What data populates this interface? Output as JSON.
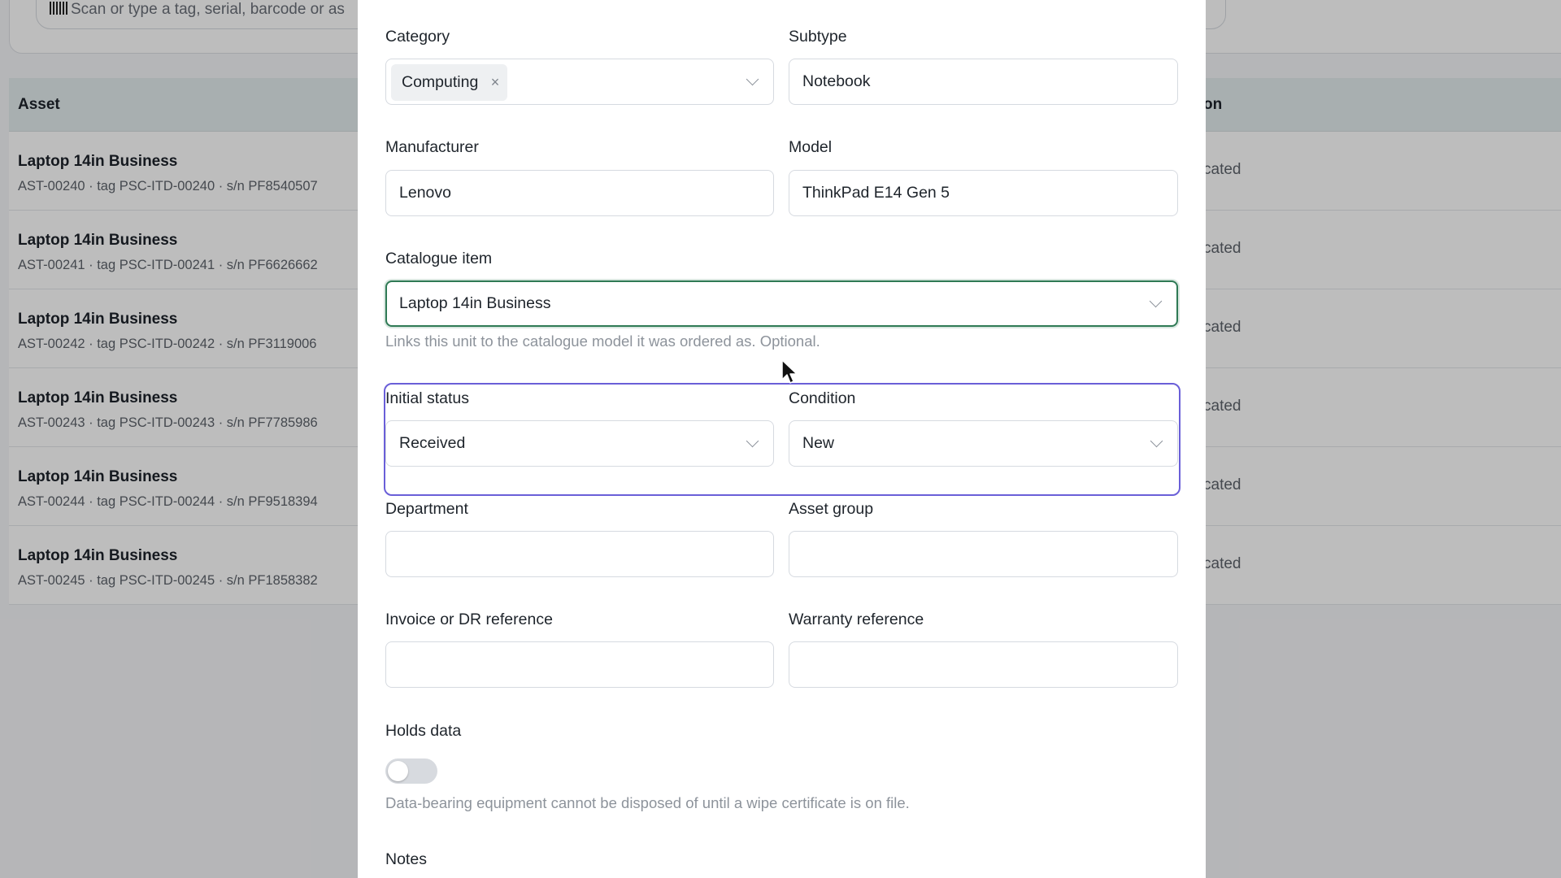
{
  "background": {
    "search_placeholder": "Scan or type a tag, serial, barcode or as",
    "table": {
      "col_asset": "Asset",
      "col_right_partial": "on",
      "rows": [
        {
          "name": "Laptop 14in Business",
          "meta": "AST-00240 · tag PSC-ITD-00240 · s/n PF8540507",
          "status": "cated"
        },
        {
          "name": "Laptop 14in Business",
          "meta": "AST-00241 · tag PSC-ITD-00241 · s/n PF6626662",
          "status": "cated"
        },
        {
          "name": "Laptop 14in Business",
          "meta": "AST-00242 · tag PSC-ITD-00242 · s/n PF3119006",
          "status": "cated"
        },
        {
          "name": "Laptop 14in Business",
          "meta": "AST-00243 · tag PSC-ITD-00243 · s/n PF7785986",
          "status": "cated"
        },
        {
          "name": "Laptop 14in Business",
          "meta": "AST-00244 · tag PSC-ITD-00244 · s/n PF9518394",
          "status": "cated"
        },
        {
          "name": "Laptop 14in Business",
          "meta": "AST-00245 · tag PSC-ITD-00245 · s/n PF1858382",
          "status": "cated"
        }
      ]
    }
  },
  "form": {
    "category": {
      "label": "Category",
      "chip": "Computing",
      "chip_remove": "×"
    },
    "subtype": {
      "label": "Subtype",
      "value": "Notebook"
    },
    "manufacturer": {
      "label": "Manufacturer",
      "value": "Lenovo"
    },
    "model": {
      "label": "Model",
      "value": "ThinkPad E14 Gen 5"
    },
    "catalogue_item": {
      "label": "Catalogue item",
      "value": "Laptop 14in Business",
      "help": "Links this unit to the catalogue model it was ordered as. Optional."
    },
    "initial_status": {
      "label": "Initial status",
      "value": "Received"
    },
    "condition": {
      "label": "Condition",
      "value": "New"
    },
    "department": {
      "label": "Department",
      "value": ""
    },
    "asset_group": {
      "label": "Asset group",
      "value": ""
    },
    "invoice_ref": {
      "label": "Invoice or DR reference",
      "value": ""
    },
    "warranty_ref": {
      "label": "Warranty reference",
      "value": ""
    },
    "holds_data": {
      "label": "Holds data",
      "checked": false,
      "help": "Data-bearing equipment cannot be disposed of until a wipe certificate is on file."
    },
    "notes": {
      "label": "Notes"
    }
  },
  "colors": {
    "focus_green": "#2f7a55",
    "highlight_purple": "#6a5fd8"
  }
}
